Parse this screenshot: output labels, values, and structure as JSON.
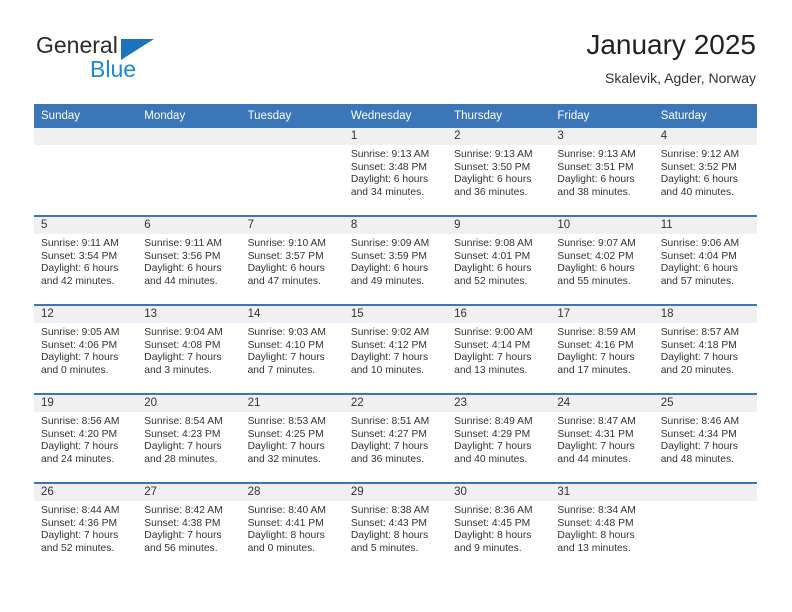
{
  "brand": {
    "name_part1": "General",
    "name_part2": "Blue",
    "triangle_color": "#1d72bd",
    "blue_color": "#1d87d6"
  },
  "header": {
    "title": "January 2025",
    "subtitle": "Skalevik, Agder, Norway"
  },
  "colors": {
    "header_blue": "#3a76b8",
    "day_band_gray": "#f0f0f0",
    "text": "#333333"
  },
  "weekdays": [
    "Sunday",
    "Monday",
    "Tuesday",
    "Wednesday",
    "Thursday",
    "Friday",
    "Saturday"
  ],
  "labels": {
    "sunrise_prefix": "Sunrise:",
    "sunset_prefix": "Sunset:",
    "daylight_prefix": "Daylight:"
  },
  "weeks": [
    [
      {
        "day": "",
        "line1": "",
        "line2": "",
        "line3": "",
        "line4": ""
      },
      {
        "day": "",
        "line1": "",
        "line2": "",
        "line3": "",
        "line4": ""
      },
      {
        "day": "",
        "line1": "",
        "line2": "",
        "line3": "",
        "line4": ""
      },
      {
        "day": "1",
        "line1": "Sunrise: 9:13 AM",
        "line2": "Sunset: 3:48 PM",
        "line3": "Daylight: 6 hours",
        "line4": "and 34 minutes."
      },
      {
        "day": "2",
        "line1": "Sunrise: 9:13 AM",
        "line2": "Sunset: 3:50 PM",
        "line3": "Daylight: 6 hours",
        "line4": "and 36 minutes."
      },
      {
        "day": "3",
        "line1": "Sunrise: 9:13 AM",
        "line2": "Sunset: 3:51 PM",
        "line3": "Daylight: 6 hours",
        "line4": "and 38 minutes."
      },
      {
        "day": "4",
        "line1": "Sunrise: 9:12 AM",
        "line2": "Sunset: 3:52 PM",
        "line3": "Daylight: 6 hours",
        "line4": "and 40 minutes."
      }
    ],
    [
      {
        "day": "5",
        "line1": "Sunrise: 9:11 AM",
        "line2": "Sunset: 3:54 PM",
        "line3": "Daylight: 6 hours",
        "line4": "and 42 minutes."
      },
      {
        "day": "6",
        "line1": "Sunrise: 9:11 AM",
        "line2": "Sunset: 3:56 PM",
        "line3": "Daylight: 6 hours",
        "line4": "and 44 minutes."
      },
      {
        "day": "7",
        "line1": "Sunrise: 9:10 AM",
        "line2": "Sunset: 3:57 PM",
        "line3": "Daylight: 6 hours",
        "line4": "and 47 minutes."
      },
      {
        "day": "8",
        "line1": "Sunrise: 9:09 AM",
        "line2": "Sunset: 3:59 PM",
        "line3": "Daylight: 6 hours",
        "line4": "and 49 minutes."
      },
      {
        "day": "9",
        "line1": "Sunrise: 9:08 AM",
        "line2": "Sunset: 4:01 PM",
        "line3": "Daylight: 6 hours",
        "line4": "and 52 minutes."
      },
      {
        "day": "10",
        "line1": "Sunrise: 9:07 AM",
        "line2": "Sunset: 4:02 PM",
        "line3": "Daylight: 6 hours",
        "line4": "and 55 minutes."
      },
      {
        "day": "11",
        "line1": "Sunrise: 9:06 AM",
        "line2": "Sunset: 4:04 PM",
        "line3": "Daylight: 6 hours",
        "line4": "and 57 minutes."
      }
    ],
    [
      {
        "day": "12",
        "line1": "Sunrise: 9:05 AM",
        "line2": "Sunset: 4:06 PM",
        "line3": "Daylight: 7 hours",
        "line4": "and 0 minutes."
      },
      {
        "day": "13",
        "line1": "Sunrise: 9:04 AM",
        "line2": "Sunset: 4:08 PM",
        "line3": "Daylight: 7 hours",
        "line4": "and 3 minutes."
      },
      {
        "day": "14",
        "line1": "Sunrise: 9:03 AM",
        "line2": "Sunset: 4:10 PM",
        "line3": "Daylight: 7 hours",
        "line4": "and 7 minutes."
      },
      {
        "day": "15",
        "line1": "Sunrise: 9:02 AM",
        "line2": "Sunset: 4:12 PM",
        "line3": "Daylight: 7 hours",
        "line4": "and 10 minutes."
      },
      {
        "day": "16",
        "line1": "Sunrise: 9:00 AM",
        "line2": "Sunset: 4:14 PM",
        "line3": "Daylight: 7 hours",
        "line4": "and 13 minutes."
      },
      {
        "day": "17",
        "line1": "Sunrise: 8:59 AM",
        "line2": "Sunset: 4:16 PM",
        "line3": "Daylight: 7 hours",
        "line4": "and 17 minutes."
      },
      {
        "day": "18",
        "line1": "Sunrise: 8:57 AM",
        "line2": "Sunset: 4:18 PM",
        "line3": "Daylight: 7 hours",
        "line4": "and 20 minutes."
      }
    ],
    [
      {
        "day": "19",
        "line1": "Sunrise: 8:56 AM",
        "line2": "Sunset: 4:20 PM",
        "line3": "Daylight: 7 hours",
        "line4": "and 24 minutes."
      },
      {
        "day": "20",
        "line1": "Sunrise: 8:54 AM",
        "line2": "Sunset: 4:23 PM",
        "line3": "Daylight: 7 hours",
        "line4": "and 28 minutes."
      },
      {
        "day": "21",
        "line1": "Sunrise: 8:53 AM",
        "line2": "Sunset: 4:25 PM",
        "line3": "Daylight: 7 hours",
        "line4": "and 32 minutes."
      },
      {
        "day": "22",
        "line1": "Sunrise: 8:51 AM",
        "line2": "Sunset: 4:27 PM",
        "line3": "Daylight: 7 hours",
        "line4": "and 36 minutes."
      },
      {
        "day": "23",
        "line1": "Sunrise: 8:49 AM",
        "line2": "Sunset: 4:29 PM",
        "line3": "Daylight: 7 hours",
        "line4": "and 40 minutes."
      },
      {
        "day": "24",
        "line1": "Sunrise: 8:47 AM",
        "line2": "Sunset: 4:31 PM",
        "line3": "Daylight: 7 hours",
        "line4": "and 44 minutes."
      },
      {
        "day": "25",
        "line1": "Sunrise: 8:46 AM",
        "line2": "Sunset: 4:34 PM",
        "line3": "Daylight: 7 hours",
        "line4": "and 48 minutes."
      }
    ],
    [
      {
        "day": "26",
        "line1": "Sunrise: 8:44 AM",
        "line2": "Sunset: 4:36 PM",
        "line3": "Daylight: 7 hours",
        "line4": "and 52 minutes."
      },
      {
        "day": "27",
        "line1": "Sunrise: 8:42 AM",
        "line2": "Sunset: 4:38 PM",
        "line3": "Daylight: 7 hours",
        "line4": "and 56 minutes."
      },
      {
        "day": "28",
        "line1": "Sunrise: 8:40 AM",
        "line2": "Sunset: 4:41 PM",
        "line3": "Daylight: 8 hours",
        "line4": "and 0 minutes."
      },
      {
        "day": "29",
        "line1": "Sunrise: 8:38 AM",
        "line2": "Sunset: 4:43 PM",
        "line3": "Daylight: 8 hours",
        "line4": "and 5 minutes."
      },
      {
        "day": "30",
        "line1": "Sunrise: 8:36 AM",
        "line2": "Sunset: 4:45 PM",
        "line3": "Daylight: 8 hours",
        "line4": "and 9 minutes."
      },
      {
        "day": "31",
        "line1": "Sunrise: 8:34 AM",
        "line2": "Sunset: 4:48 PM",
        "line3": "Daylight: 8 hours",
        "line4": "and 13 minutes."
      },
      {
        "day": "",
        "line1": "",
        "line2": "",
        "line3": "",
        "line4": ""
      }
    ]
  ]
}
